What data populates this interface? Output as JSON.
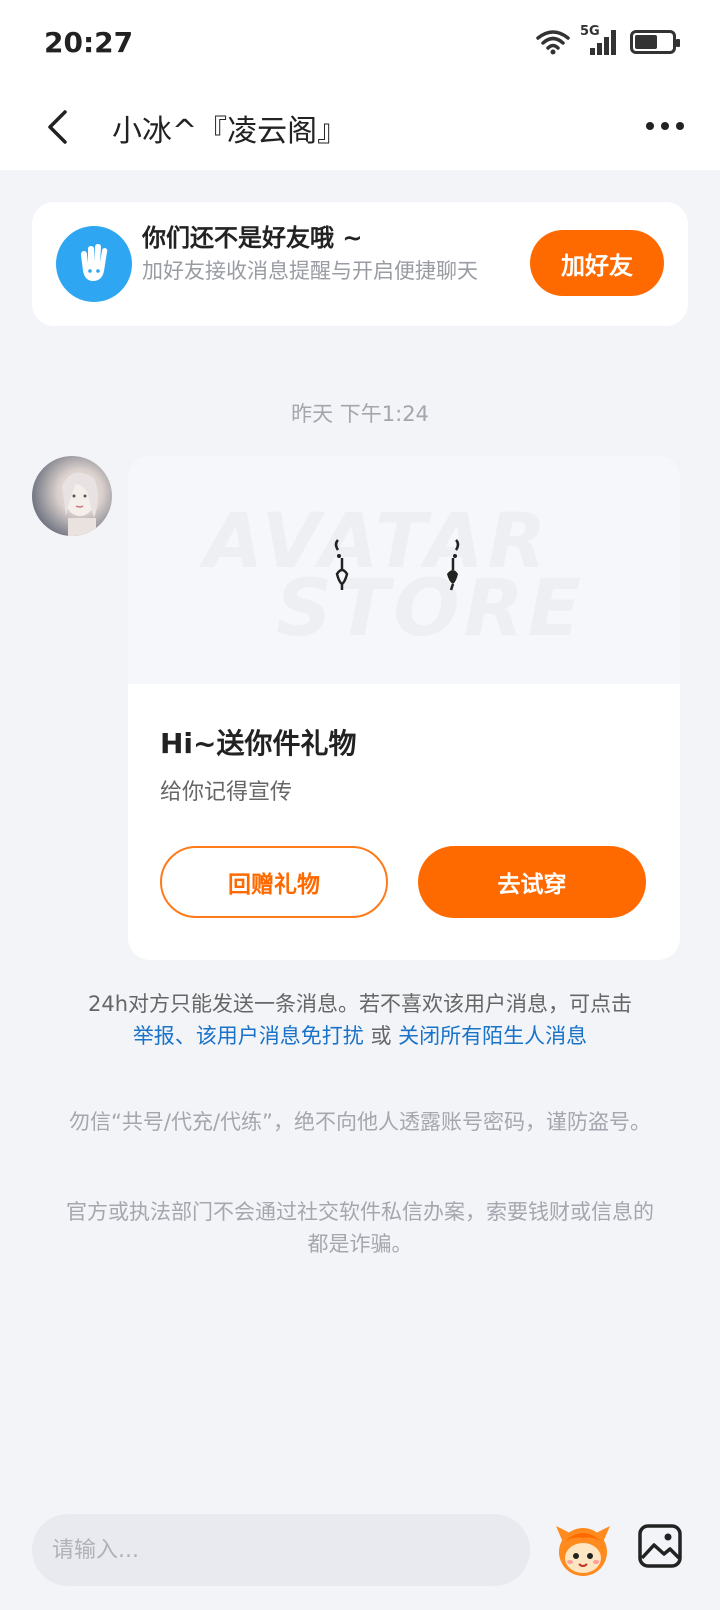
{
  "status_bar": {
    "time": "20:27",
    "network": "5G",
    "wifi_icon": "wifi-icon",
    "signal_icon": "signal-icon",
    "battery_icon": "battery-icon",
    "battery_level": 0.6
  },
  "header": {
    "title": "小冰^『凌云阁』",
    "back_icon": "chevron-left-icon",
    "more_icon": "more-horizontal-icon"
  },
  "friend_banner": {
    "title": "你们还不是好友哦 ~",
    "subtitle": "加好友接收消息提醒与开启便捷聊天",
    "add_button": "加好友",
    "icon": "hand-wave-icon",
    "accent": "#2ea6f2"
  },
  "conversation": {
    "timestamp": "昨天 下午1:24",
    "message": {
      "avatar_icon": "user-avatar",
      "watermark_line1": "AVATAR",
      "watermark_line2": "STORE",
      "title": "Hi~送你件礼物",
      "description": "给你记得宣传",
      "return_gift_button": "回赠礼物",
      "try_on_button": "去试穿"
    }
  },
  "notice": {
    "text": "24h对方只能发送一条消息。若不喜欢该用户消息，可点击",
    "report_link": "举报",
    "separator": "、",
    "mute_link": "该用户消息免打扰",
    "or_text": " 或 ",
    "close_link": "关闭所有陌生人消息"
  },
  "warnings": [
    "勿信“共号/代充/代练”，绝不向他人透露账号密码，谨防盗号。",
    "官方或执法部门不会通过社交软件私信办案，索要钱财或信息的都是诈骗。"
  ],
  "input_bar": {
    "placeholder": "请输入...",
    "mascot_icon": "mascot-emoji-icon",
    "image_icon": "image-picker-icon"
  },
  "colors": {
    "accent_orange": "#ff6a00",
    "link_blue": "#1a73c8",
    "background": "#f3f4f8"
  }
}
